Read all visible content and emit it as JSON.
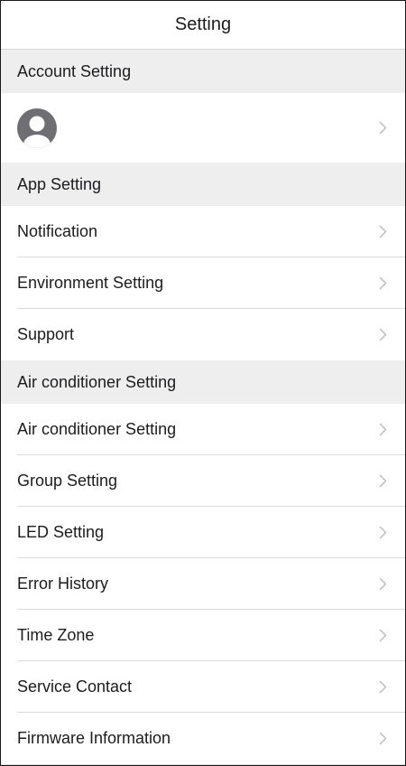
{
  "nav": {
    "title": "Setting"
  },
  "account_section": {
    "header": "Account Setting",
    "avatar_icon": "user-avatar-icon",
    "chevron_icon": "chevron-right-icon"
  },
  "app_section": {
    "header": "App Setting",
    "items": [
      {
        "label": "Notification"
      },
      {
        "label": "Environment Setting"
      },
      {
        "label": "Support"
      }
    ]
  },
  "ac_section": {
    "header": "Air conditioner Setting",
    "items": [
      {
        "label": "Air conditioner Setting"
      },
      {
        "label": "Group Setting"
      },
      {
        "label": "LED Setting"
      },
      {
        "label": "Error History"
      },
      {
        "label": "Time Zone"
      },
      {
        "label": "Service Contact"
      },
      {
        "label": "Firmware Information"
      }
    ]
  },
  "colors": {
    "section_bg": "#eeeeef",
    "separator": "#dcdcdf",
    "chevron": "#c4c4c7",
    "avatar": "#6e6e73"
  }
}
